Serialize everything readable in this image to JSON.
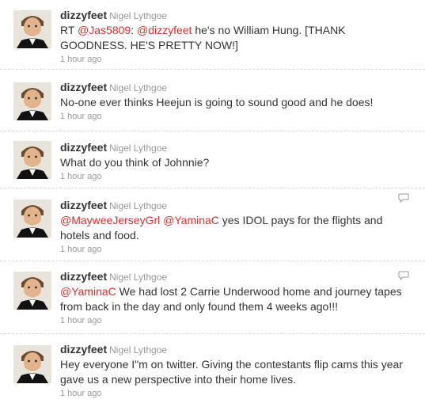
{
  "tweets": [
    {
      "username": "dizzyfeet",
      "fullname": "Nigel Lythgoe",
      "segments": [
        {
          "t": "RT "
        },
        {
          "t": "@Jas5809",
          "m": true
        },
        {
          "t": ": "
        },
        {
          "t": "@dizzyfeet",
          "m": true
        },
        {
          "t": " he's no William Hung. [THANK GOODNESS. HE'S PRETTY NOW!]"
        }
      ],
      "time": "1 hour ago",
      "reply": false
    },
    {
      "username": "dizzyfeet",
      "fullname": "Nigel Lythgoe",
      "segments": [
        {
          "t": "No-one ever thinks Heejun is going to sound good and he does!"
        }
      ],
      "time": "1 hour ago",
      "reply": false
    },
    {
      "username": "dizzyfeet",
      "fullname": "Nigel Lythgoe",
      "segments": [
        {
          "t": "What do you think of Johnnie?"
        }
      ],
      "time": "1 hour ago",
      "reply": false
    },
    {
      "username": "dizzyfeet",
      "fullname": "Nigel Lythgoe",
      "segments": [
        {
          "t": "@MayweeJerseyGrl",
          "m": true
        },
        {
          "t": " "
        },
        {
          "t": "@YaminaC",
          "m": true
        },
        {
          "t": " yes IDOL pays for the flights and hotels and food."
        }
      ],
      "time": "1 hour ago",
      "reply": true,
      "reply_icon": "reply-icon"
    },
    {
      "username": "dizzyfeet",
      "fullname": "Nigel Lythgoe",
      "segments": [
        {
          "t": "@YaminaC",
          "m": true
        },
        {
          "t": " We had lost 2 Carrie Underwood home and journey tapes from back in the day and only found them 4 weeks ago!!!"
        }
      ],
      "time": "1 hour ago",
      "reply": true,
      "reply_icon": "reply-icon"
    },
    {
      "username": "dizzyfeet",
      "fullname": "Nigel Lythgoe",
      "segments": [
        {
          "t": "Hey everyone I\"m on twitter. Giving the contestants flip cams this year gave us a new perspective into their home lives."
        }
      ],
      "time": "1 hour ago",
      "reply": false
    }
  ],
  "colors": {
    "username": "#333333",
    "fullname": "#999999",
    "mention": "#cc3333",
    "time": "#999999",
    "divider": "#d8d8d8"
  }
}
